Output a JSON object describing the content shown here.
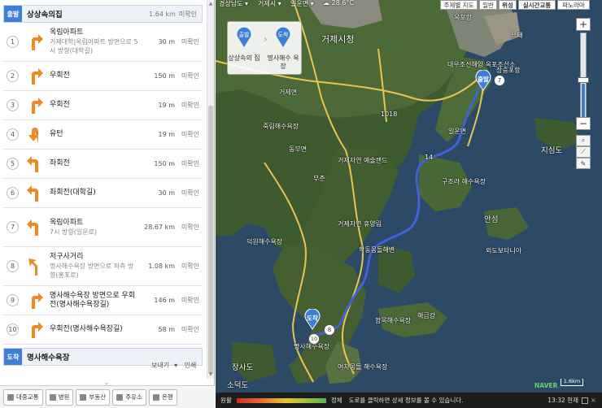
{
  "route": {
    "start": {
      "tag": "출발",
      "name": "상상속의집",
      "dist": "1.64 km",
      "cctv": "미확인"
    },
    "end": {
      "tag": "도착",
      "name": "명사해수욕장"
    },
    "steps": [
      {
        "n": "1",
        "main": "옥림아파트",
        "sub": "거제대학|옥림아파트 방면으로 5시 방향(대학길)",
        "dist": "30 m",
        "cctv": "미확인",
        "arrow": "right"
      },
      {
        "n": "2",
        "main": "우회전",
        "sub": "",
        "dist": "150 m",
        "cctv": "미확인",
        "arrow": "right"
      },
      {
        "n": "3",
        "main": "우회전",
        "sub": "",
        "dist": "19 m",
        "cctv": "미확인",
        "arrow": "right"
      },
      {
        "n": "4",
        "main": "유턴",
        "sub": "",
        "dist": "19 m",
        "cctv": "미확인",
        "arrow": "uturn"
      },
      {
        "n": "5",
        "main": "좌회전",
        "sub": "",
        "dist": "150 m",
        "cctv": "미확인",
        "arrow": "left"
      },
      {
        "n": "6",
        "main": "좌회전(대학길)",
        "sub": "",
        "dist": "30 m",
        "cctv": "미확인",
        "arrow": "left"
      },
      {
        "n": "7",
        "main": "옥림아파트",
        "sub": "7시 방향(일운로)",
        "dist": "28.67 km",
        "cctv": "미확인",
        "arrow": "left"
      },
      {
        "n": "8",
        "main": "저구사거리",
        "sub": "명사해수욕장 방면으로 좌측 방향(홍포로)",
        "dist": "1.08 km",
        "cctv": "미확인",
        "arrow": "slight-left"
      },
      {
        "n": "9",
        "main": "명사해수욕장 방면으로 우회전(명사해수욕장길)",
        "sub": "",
        "dist": "146 m",
        "cctv": "미확인",
        "arrow": "right"
      },
      {
        "n": "10",
        "main": "우회전(명사해수욕장길)",
        "sub": "",
        "dist": "58 m",
        "cctv": "미확인",
        "arrow": "right"
      }
    ],
    "footer": {
      "send": "보내기",
      "print": "인쇄"
    }
  },
  "toolbar": [
    {
      "label": "대중교통",
      "name": "public-transport-button"
    },
    {
      "label": "병원",
      "name": "hospital-button"
    },
    {
      "label": "부동산",
      "name": "real-estate-button"
    },
    {
      "label": "주유소",
      "name": "gas-station-button"
    },
    {
      "label": "은행",
      "name": "bank-button"
    }
  ],
  "map": {
    "topbar": {
      "region1": "경상남도",
      "region2": "거제시",
      "region3": "일운면",
      "weather": "28.6°C",
      "buttons": [
        "주제별 지도",
        "일반",
        "위성",
        "실시간교통",
        "파노라마"
      ]
    },
    "legend": {
      "start_tag": "출발",
      "start_label": "상상속의 집",
      "end_tag": "도착",
      "end_label": "명사해수 욕장"
    },
    "places": [
      "거제시청",
      "옥포항",
      "느태",
      "대우조선해양 옥포조선소",
      "장승포항",
      "거제면",
      "죽림해수욕장",
      "일운면",
      "지심도",
      "동부면",
      "부춘",
      "거제자연 예술랜드",
      "구조라 해수욕장",
      "거제자연 휴양림",
      "안섬",
      "덕원해수욕장",
      "학동몽돌해변",
      "외도보타니아",
      "해금강",
      "함목해수욕장",
      "명사해수욕장",
      "여차몽돌 해수욕장",
      "장사도",
      "소덕도",
      "1018",
      "14"
    ],
    "markers": {
      "start": "출발",
      "end": "도착",
      "seven": "7",
      "eight": "8",
      "ten": "10"
    },
    "scale": "1.6km",
    "logo": "NAVER",
    "traffic": {
      "good": "원활",
      "jam": "정체",
      "message": "도로를 클릭하면 상세 정보를 볼 수 있습니다.",
      "time": "13:32 현재"
    },
    "colors": {
      "route": "#3f62d8",
      "road": "#e8c550",
      "accent": "#3d7fd4"
    }
  }
}
